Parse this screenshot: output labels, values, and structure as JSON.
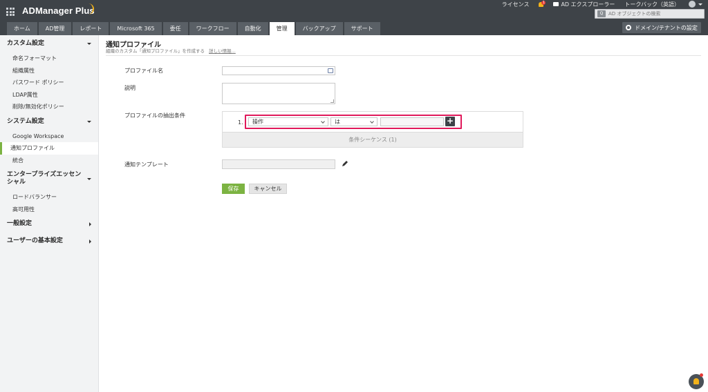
{
  "app": {
    "name": "ADManager Plus"
  },
  "top_links": {
    "license": "ライセンス",
    "notification_count": "1",
    "ad_explorer": "AD エクスプローラー",
    "talkback": "トークバック（英語）"
  },
  "search": {
    "placeholder": "AD オブジェクトの検索"
  },
  "tabs": [
    {
      "label": "ホーム"
    },
    {
      "label": "AD管理"
    },
    {
      "label": "レポート"
    },
    {
      "label": "Microsoft 365"
    },
    {
      "label": "委任"
    },
    {
      "label": "ワークフロー"
    },
    {
      "label": "自動化"
    },
    {
      "label": "管理",
      "active": true
    },
    {
      "label": "バックアップ"
    },
    {
      "label": "サポート"
    }
  ],
  "domain_settings_label": "ドメイン/テナントの設定",
  "sidebar": {
    "sections": [
      {
        "title": "カスタム設定",
        "expanded": true,
        "items": [
          "命名フォーマット",
          "組織属性",
          "パスワード ポリシー",
          "LDAP属性",
          "削除/無効化ポリシー"
        ]
      },
      {
        "title": "システム設定",
        "expanded": true,
        "items": [
          "Google Workspace",
          "通知プロファイル",
          "統合"
        ]
      },
      {
        "title": "エンタープライズエッセンシャル",
        "expanded": true,
        "items": [
          "ロードバランサー",
          "高可用性"
        ]
      },
      {
        "title": "一般設定",
        "expanded": false,
        "items": []
      },
      {
        "title": "ユーザーの基本設定",
        "expanded": false,
        "items": []
      }
    ],
    "active_item": "通知プロファイル"
  },
  "page": {
    "title": "通知プロファイル",
    "subtitle": "組織のカスタム「通知プロファイル」を作成する",
    "more_link": "詳しい情報..."
  },
  "form": {
    "profile_name_label": "プロファイル名",
    "profile_name_value": "",
    "description_label": "説明",
    "description_value": "",
    "criteria_label": "プロファイルの抽出条件",
    "criteria": {
      "index": "1.",
      "field": "操作",
      "operator": "は",
      "value": ""
    },
    "criteria_sequence": "条件シーケンス (1)",
    "template_label": "通知テンプレート",
    "template_value": "",
    "save_label": "保存",
    "cancel_label": "キャンセル"
  },
  "colors": {
    "header_bg": "#3e4348",
    "accent_green": "#7cb342",
    "highlight": "#e0185a"
  }
}
